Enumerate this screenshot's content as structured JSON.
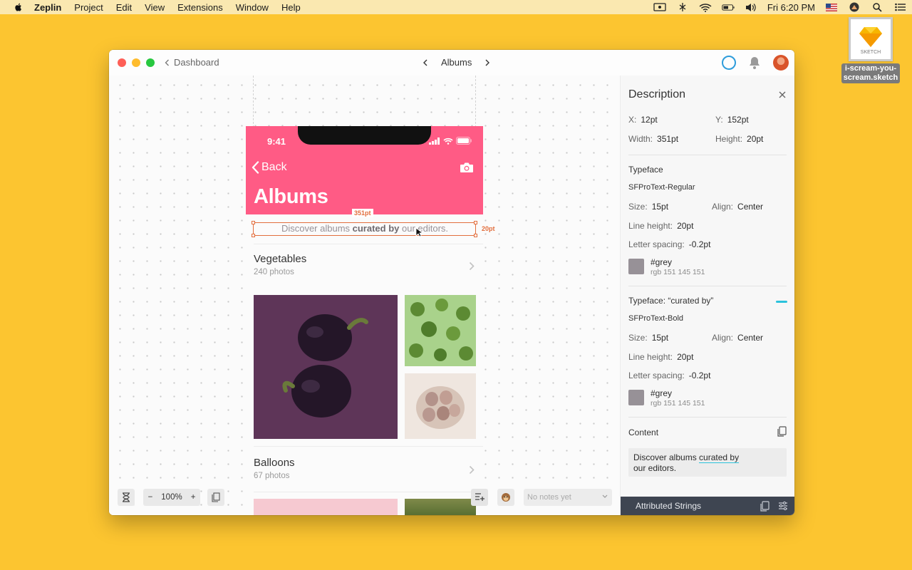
{
  "menubar": {
    "app": "Zeplin",
    "items": [
      "Project",
      "Edit",
      "View",
      "Extensions",
      "Window",
      "Help"
    ],
    "clock": "Fri 6:20 PM"
  },
  "desktop": {
    "file_name_line1": "i-scream-you-",
    "file_name_line2": "scream.sketch",
    "file_tag": "SKETCH"
  },
  "window": {
    "breadcrumb": "Dashboard",
    "screen_title": "Albums"
  },
  "phone": {
    "time": "9:41",
    "back_label": "Back",
    "title": "Albums",
    "subtitle_pre": "Discover albums ",
    "subtitle_bold": "curated by",
    "subtitle_post": " our editors.",
    "albums": [
      {
        "name": "Vegetables",
        "count": "240 photos"
      },
      {
        "name": "Balloons",
        "count": "67 photos"
      }
    ]
  },
  "measure": {
    "width_tag": "351pt",
    "height_tag": "20pt"
  },
  "controls": {
    "zoom": "100%",
    "notes_placeholder": "No notes yet"
  },
  "panel": {
    "title": "Description",
    "x_label": "X:",
    "x_value": "12pt",
    "y_label": "Y:",
    "y_value": "152pt",
    "width_label": "Width:",
    "width_value": "351pt",
    "height_label": "Height:",
    "height_value": "20pt",
    "typeface_heading": "Typeface",
    "typeface1": {
      "font": "SFProText-Regular",
      "size_label": "Size:",
      "size": "15pt",
      "align_label": "Align:",
      "align": "Center",
      "lh_label": "Line height:",
      "lh": "20pt",
      "ls_label": "Letter spacing:",
      "ls": "-0.2pt",
      "color_name": "#grey",
      "color_rgb": "rgb 151 145 151"
    },
    "typeface2_heading": "Typeface: “curated by”",
    "typeface2": {
      "font": "SFProText-Bold",
      "size_label": "Size:",
      "size": "15pt",
      "align_label": "Align:",
      "align": "Center",
      "lh_label": "Line height:",
      "lh": "20pt",
      "ls_label": "Letter spacing:",
      "ls": "-0.2pt",
      "color_name": "#grey",
      "color_rgb": "rgb 151 145 151"
    },
    "content_heading": "Content",
    "content_pre": "Discover albums ",
    "content_link": "curated by",
    "content_post": "our editors.",
    "attributed_strings": "Attributed Strings"
  },
  "colors": {
    "desktop": "#FCC530",
    "header_pink": "#FF5B85",
    "measure_orange": "#E26E3D",
    "swatch_grey": "#979197",
    "accent_cyan": "#2BC2DC"
  }
}
